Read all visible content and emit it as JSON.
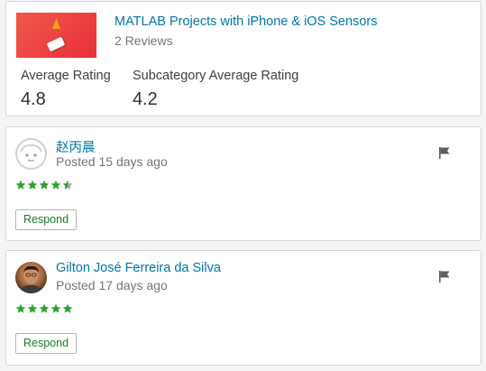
{
  "summary": {
    "course_title": "MATLAB Projects with iPhone & iOS Sensors",
    "review_count": "2 Reviews",
    "average_rating_label": "Average Rating",
    "average_rating_value": "4.8",
    "subcategory_rating_label": "Subcategory Average Rating",
    "subcategory_rating_value": "4.2"
  },
  "reviews": [
    {
      "name": "赵丙晨",
      "posted": "Posted 15 days ago",
      "rating": 4.5,
      "respond_label": "Respond",
      "avatar": "default-avatar-icon"
    },
    {
      "name": "Gilton José Ferreira da Silva",
      "posted": "Posted 17 days ago",
      "rating": 5,
      "respond_label": "Respond",
      "avatar": "user-photo"
    }
  ],
  "colors": {
    "link": "#0076a8",
    "star": "#2aa32a",
    "star_empty": "#9e9e9e",
    "respond_text": "#1a7a2a"
  },
  "icons": {
    "flag": "flag-icon",
    "star": "star-icon"
  }
}
